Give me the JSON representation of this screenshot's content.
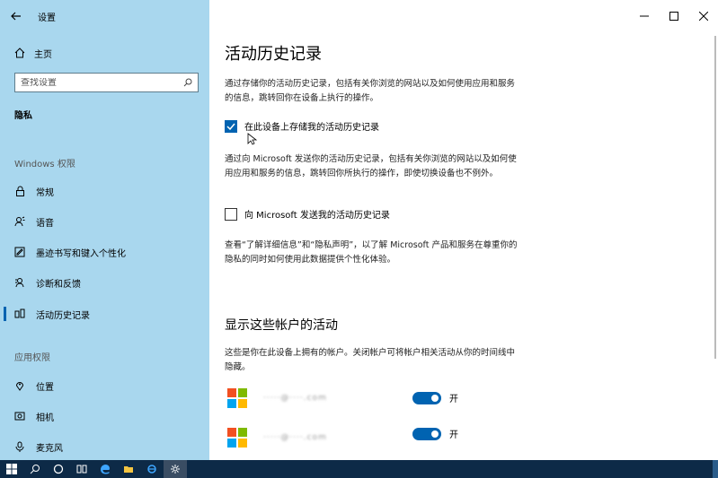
{
  "window": {
    "title": "设置"
  },
  "sidebar": {
    "home_label": "主页",
    "search_placeholder": "查找设置",
    "section_title": "隐私",
    "group_windows": "Windows 权限",
    "group_app": "应用权限",
    "items_windows": [
      {
        "label": "常规",
        "icon": "lock-icon"
      },
      {
        "label": "语音",
        "icon": "speech-icon"
      },
      {
        "label": "墨迹书写和键入个性化",
        "icon": "ink-icon"
      },
      {
        "label": "诊断和反馈",
        "icon": "diagnostics-icon"
      },
      {
        "label": "活动历史记录",
        "icon": "activity-history-icon",
        "active": true
      }
    ],
    "items_app": [
      {
        "label": "位置",
        "icon": "location-icon"
      },
      {
        "label": "相机",
        "icon": "camera-icon"
      },
      {
        "label": "麦克风",
        "icon": "microphone-icon"
      }
    ]
  },
  "main": {
    "title": "活动历史记录",
    "desc1": "通过存储你的活动历史记录，包括有关你浏览的网站以及如何使用应用和服务的信息，跳转回你在设备上执行的操作。",
    "store_checkbox": {
      "label": "在此设备上存储我的活动历史记录",
      "checked": true
    },
    "desc2": "通过向 Microsoft 发送你的活动历史记录，包括有关你浏览的网站以及如何使用应用和服务的信息，跳转回你所执行的操作，即使切换设备也不例外。",
    "send_checkbox": {
      "label": "向 Microsoft 发送我的活动历史记录",
      "checked": false
    },
    "desc3": "查看“了解详细信息”和“隐私声明”，以了解 Microsoft 产品和服务在尊重你的隐私的同时如何使用此数据提供个性化体验。",
    "accounts_title": "显示这些帐户的活动",
    "accounts_desc": "这些是你在此设备上拥有的帐户。关闭帐户可将帐户相关活动从你的时间线中隐藏。",
    "accounts": [
      {
        "name": "·····@····.com",
        "toggle_label": "开",
        "on": true
      },
      {
        "name": "·····@····.com",
        "toggle_label": "开",
        "on": true
      }
    ]
  },
  "colors": {
    "sidebar_bg": "#a9d7ee",
    "accent": "#0063b1",
    "taskbar": "#0d2a47"
  }
}
